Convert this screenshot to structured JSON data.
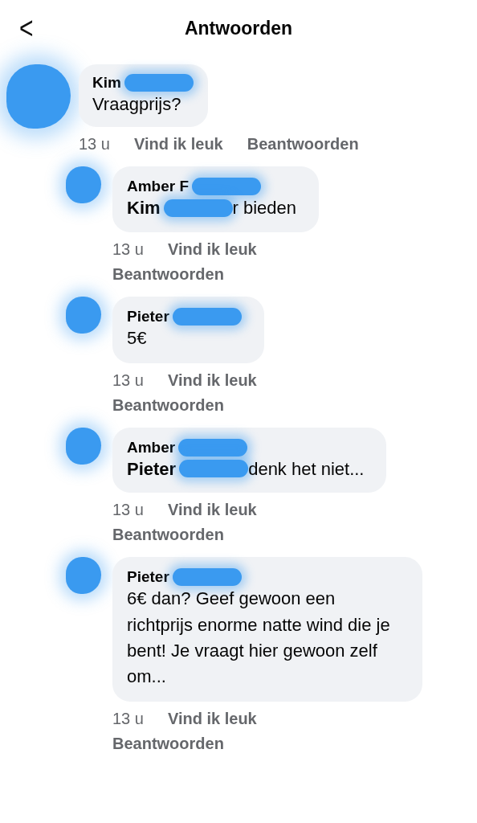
{
  "header": {
    "back": "<",
    "title": "Antwoorden"
  },
  "comment": {
    "author": "Kim",
    "author_redacted": true,
    "text": "Vraagprijs?",
    "time": "13 u",
    "like": "Vind ik leuk",
    "reply": "Beantwoorden",
    "children": [
      {
        "author": "Amber F",
        "author_redacted": true,
        "mention": "Kim",
        "mention_redacted": true,
        "text": "r bieden",
        "time": "13 u",
        "like": "Vind ik leuk",
        "reply": "Beantwoorden"
      },
      {
        "author": "Pieter",
        "author_redacted": true,
        "text": "5€",
        "time": "13 u",
        "like": "Vind ik leuk",
        "reply": "Beantwoorden"
      },
      {
        "author": "Amber",
        "author_redacted": true,
        "mention": "Pieter",
        "mention_redacted": true,
        "text": "denk het niet...",
        "time": "13 u",
        "like": "Vind ik leuk",
        "reply": "Beantwoorden"
      },
      {
        "author": "Pieter",
        "author_redacted": true,
        "text": "6€ dan? Geef gewoon een richtprijs enorme natte wind die je bent! Je vraagt hier gewoon zelf om...",
        "time": "13 u",
        "like": "Vind ik leuk",
        "reply": "Beantwoorden"
      }
    ]
  }
}
